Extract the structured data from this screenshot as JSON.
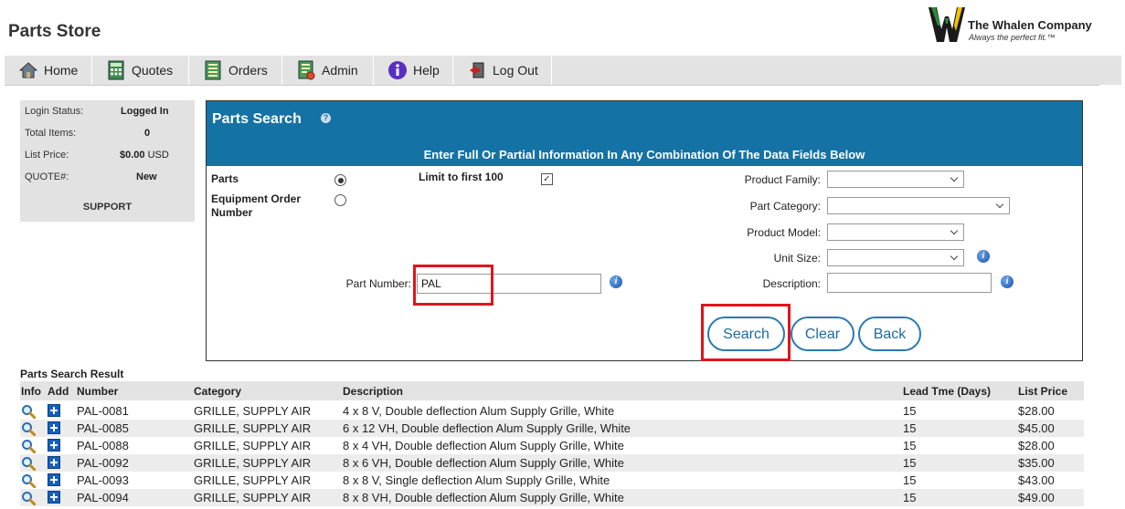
{
  "app": {
    "title": "Parts Store",
    "logo_name": "The Whalen Company",
    "logo_tagline": "Always the perfect fit.™"
  },
  "nav": [
    {
      "label": "Home",
      "icon": "home-icon"
    },
    {
      "label": "Quotes",
      "icon": "calculator-icon"
    },
    {
      "label": "Orders",
      "icon": "document-list-icon"
    },
    {
      "label": "Admin",
      "icon": "admin-document-icon"
    },
    {
      "label": "Help",
      "icon": "info-icon"
    },
    {
      "label": "Log Out",
      "icon": "logout-icon"
    }
  ],
  "status_panel": {
    "login_status_label": "Login Status:",
    "login_status_value": "Logged In",
    "total_items_label": "Total Items:",
    "total_items_value": "0",
    "list_price_label": "List Price:",
    "list_price_value": "$0.00",
    "list_price_currency": "USD",
    "quote_label": "QUOTE#:",
    "quote_value": "New",
    "support_label": "SUPPORT"
  },
  "search": {
    "title": "Parts Search",
    "help_glyph": "?",
    "instructions": "Enter Full Or Partial Information In Any Combination Of The Data Fields Below",
    "mode_parts_label": "Parts",
    "mode_equipment_label_line1": "Equipment Order",
    "mode_equipment_label_line2": "Number",
    "limit_label": "Limit to first 100",
    "part_number_label": "Part Number:",
    "part_number_value": "PAL",
    "product_family_label": "Product Family:",
    "part_category_label": "Part Category:",
    "product_model_label": "Product Model:",
    "unit_size_label": "Unit Size:",
    "description_label": "Description:",
    "search_button": "Search",
    "clear_button": "Clear",
    "back_button": "Back",
    "info_glyph": "i"
  },
  "results": {
    "title": "Parts Search Result",
    "columns": [
      "Info",
      "Add",
      "Number",
      "Category",
      "Description",
      "Lead Tme (Days)",
      "List Price"
    ],
    "rows": [
      {
        "number": "PAL-0081",
        "category": "GRILLE, SUPPLY AIR",
        "description": "4 x 8 V, Double deflection Alum Supply Grille, White",
        "lead": "15",
        "price": "$28.00"
      },
      {
        "number": "PAL-0085",
        "category": "GRILLE, SUPPLY AIR",
        "description": "6 x 12 VH, Double deflection Alum Supply Grille, White",
        "lead": "15",
        "price": "$45.00"
      },
      {
        "number": "PAL-0088",
        "category": "GRILLE, SUPPLY AIR",
        "description": "8 x 4 VH, Double deflection Alum Supply Grille, White",
        "lead": "15",
        "price": "$28.00"
      },
      {
        "number": "PAL-0092",
        "category": "GRILLE, SUPPLY AIR",
        "description": "8 x 6 VH, Double deflection Alum Supply Grille, White",
        "lead": "15",
        "price": "$35.00"
      },
      {
        "number": "PAL-0093",
        "category": "GRILLE, SUPPLY AIR",
        "description": "8 x 8 V, Single deflection Alum Supply Grille, White",
        "lead": "15",
        "price": "$43.00"
      },
      {
        "number": "PAL-0094",
        "category": "GRILLE, SUPPLY AIR",
        "description": "8 x 8 VH, Double deflection Alum Supply Grille, White",
        "lead": "15",
        "price": "$49.00"
      }
    ]
  },
  "colors": {
    "header_blue": "#1472a5",
    "highlight_red": "#e0141e",
    "button_border": "#2a7ab0"
  }
}
